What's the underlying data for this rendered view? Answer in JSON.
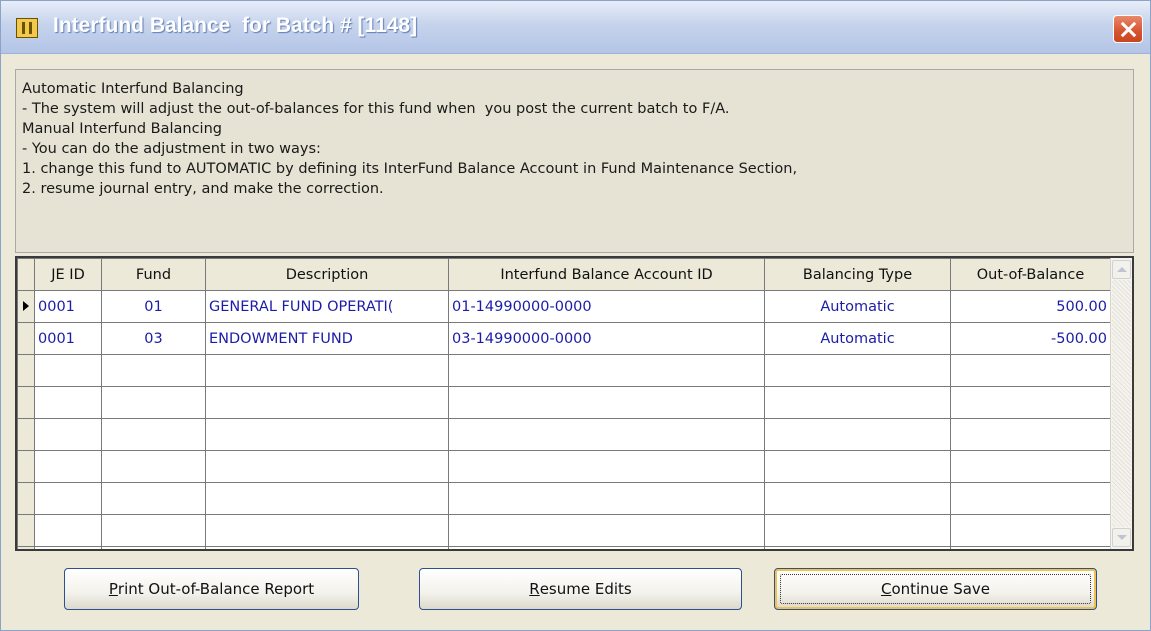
{
  "window": {
    "title": "Interfund Balance  for Batch # [1148]",
    "icon": "form-icon"
  },
  "info": {
    "lines": [
      "Automatic Interfund Balancing",
      "- The system will adjust the out-of-balances for this fund when  you post the current batch to F/A.",
      "Manual Interfund Balancing",
      "- You can do the adjustment in two ways:",
      "1. change this fund to AUTOMATIC by defining its InterFund Balance Account in Fund Maintenance Section,",
      "2. resume journal entry, and make the correction."
    ]
  },
  "grid": {
    "columns": [
      "JE ID",
      "Fund",
      "Description",
      "Interfund Balance Account ID",
      "Balancing Type",
      "Out-of-Balance"
    ],
    "rows": [
      {
        "je_id": "0001",
        "fund": "01",
        "description": "GENERAL FUND OPERATI(",
        "account_id": "01-14990000-0000",
        "balancing_type": "Automatic",
        "out_of_balance": "500.00"
      },
      {
        "je_id": "0001",
        "fund": "03",
        "description": "ENDOWMENT FUND",
        "account_id": "03-14990000-0000",
        "balancing_type": "Automatic",
        "out_of_balance": "-500.00"
      }
    ]
  },
  "buttons": {
    "print": {
      "mnemonic": "P",
      "rest": "rint Out-of-Balance Report"
    },
    "resume": {
      "mnemonic": "R",
      "rest": "esume Edits"
    },
    "continue": {
      "mnemonic": "C",
      "rest": "ontinue Save"
    }
  },
  "colors": {
    "title_bar": "#c6d3ec",
    "cell_text": "#1c1ca8",
    "close_button": "#d5532f",
    "default_button_highlight": "#f0c24a"
  }
}
